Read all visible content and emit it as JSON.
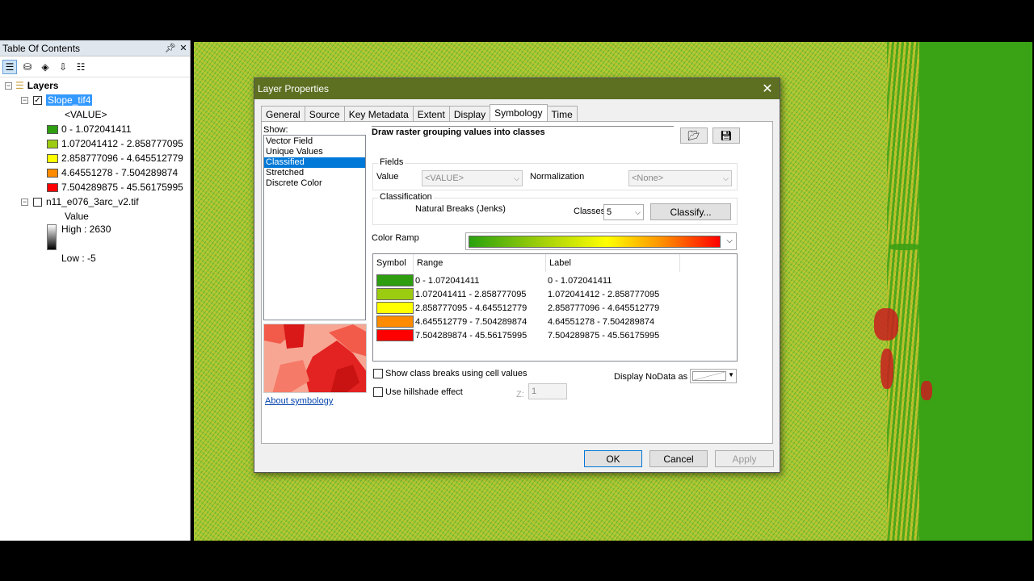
{
  "toc": {
    "title": "Table Of Contents",
    "pin": "→",
    "close": "✕",
    "root": "Layers",
    "layer1": {
      "name": "Slope_tif4",
      "field": "<VALUE>",
      "classes": [
        {
          "label": "0 - 1.072041411",
          "color": "#2e9e10"
        },
        {
          "label": "1.072041412 - 2.858777095",
          "color": "#9ccc10"
        },
        {
          "label": "2.858777096 - 4.645512779",
          "color": "#ffff00"
        },
        {
          "label": "4.64551278 - 7.504289874",
          "color": "#ff8c00"
        },
        {
          "label": "7.504289875 - 45.56175995",
          "color": "#ff0000"
        }
      ]
    },
    "layer2": {
      "name": "n11_e076_3arc_v2.tif",
      "field": "Value",
      "high": "High : 2630",
      "low": "Low : -5"
    }
  },
  "dialog": {
    "title": "Layer Properties",
    "close": "✕",
    "tabs": [
      "General",
      "Source",
      "Key Metadata",
      "Extent",
      "Display",
      "Symbology",
      "Time"
    ],
    "active_tab": "Symbology",
    "show_label": "Show:",
    "show_items": [
      "Vector Field",
      "Unique Values",
      "Classified",
      "Stretched",
      "Discrete Color"
    ],
    "selected_show": "Classified",
    "about_link": "About symbology",
    "heading": "Draw raster grouping values into classes",
    "fields_title": "Fields",
    "value_label": "Value",
    "value_combo": "<VALUE>",
    "normalization_label": "Normalization",
    "normalization_combo": "<None>",
    "classification_title": "Classification",
    "method": "Natural Breaks (Jenks)",
    "classes_label": "Classes",
    "classes_value": "5",
    "classify_button": "Classify...",
    "color_ramp_label": "Color Ramp",
    "table_headers": {
      "symbol": "Symbol",
      "range": "Range",
      "label": "Label"
    },
    "rows": [
      {
        "color": "#2e9e10",
        "range": "0 - 1.072041411",
        "label": "0 - 1.072041411"
      },
      {
        "color": "#9ccc10",
        "range": "1.072041411 - 2.858777095",
        "label": "1.072041412 - 2.858777095"
      },
      {
        "color": "#ffff00",
        "range": "2.858777095 - 4.645512779",
        "label": "2.858777096 - 4.645512779"
      },
      {
        "color": "#ff8c00",
        "range": "4.645512779 - 7.504289874",
        "label": "4.64551278 - 7.504289874"
      },
      {
        "color": "#ff0000",
        "range": "7.504289874 - 45.56175995",
        "label": "7.504289875 - 45.56175995"
      }
    ],
    "show_class_breaks": "Show class breaks using cell values",
    "use_hillshade": "Use hillshade effect",
    "z_label": "Z:",
    "z_value": "1",
    "nodata_label": "Display NoData as",
    "ok": "OK",
    "cancel": "Cancel",
    "apply": "Apply"
  }
}
